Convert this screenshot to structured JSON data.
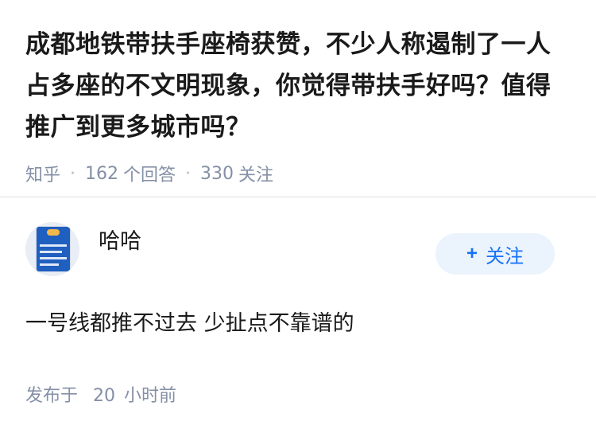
{
  "question": {
    "title": "成都地铁带扶手座椅获赞，不少人称遏制了一人占多座的不文明现象，你觉得带扶手好吗？值得推广到更多城市吗？",
    "source": "知乎",
    "answer_count": "162",
    "answer_count_label": "个回答",
    "follower_count": "330",
    "follower_count_label": "关注"
  },
  "answer": {
    "author_name": "哈哈",
    "follow_label": "关注",
    "content": "一号线都推不过去 少扯点不靠谱的",
    "published_label": "发布于",
    "published_num": "20",
    "published_unit": "小时前"
  },
  "icons": {
    "follow": "plus-icon",
    "avatar": "news-card-avatar"
  },
  "colors": {
    "accent": "#1772f6",
    "follow_bg": "#ebf3fd",
    "meta_text": "#8590a6",
    "avatar_card": "#1f5fbf"
  }
}
